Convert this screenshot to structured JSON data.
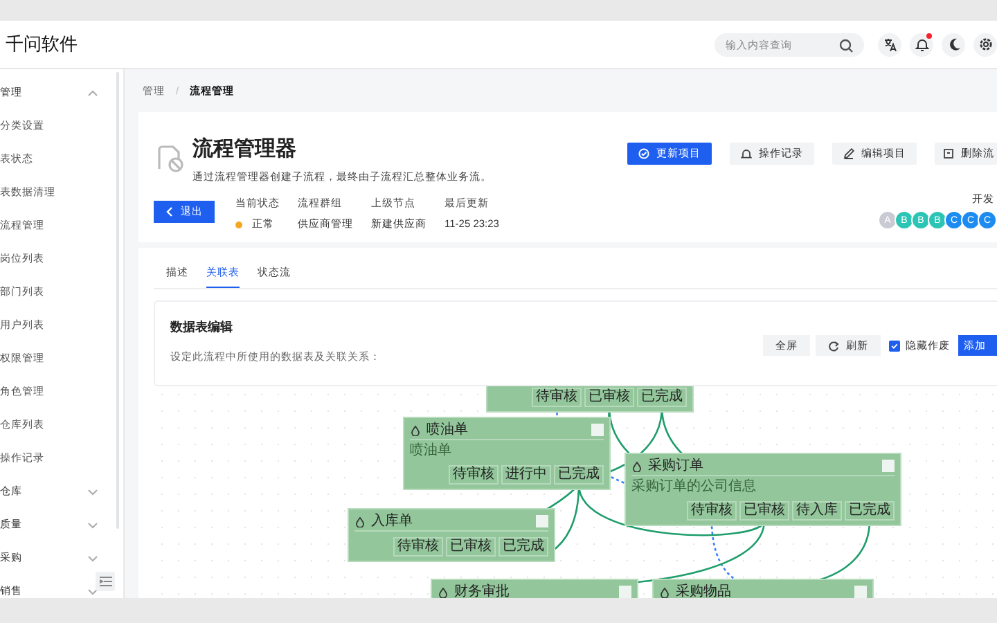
{
  "app": {
    "title": "千问软件"
  },
  "search": {
    "placeholder": "输入内容查询"
  },
  "toolbar_icons": [
    {
      "kind": "translate",
      "badge": false
    },
    {
      "kind": "bell",
      "badge": true
    },
    {
      "kind": "moon",
      "badge": false
    },
    {
      "kind": "settings",
      "badge": false
    }
  ],
  "sidebar": {
    "items": [
      {
        "label": "管理",
        "expanded": true,
        "children": [
          {
            "label": "分类设置"
          },
          {
            "label": "表状态"
          },
          {
            "label": "表数据清理"
          },
          {
            "label": "流程管理"
          },
          {
            "label": "岗位列表"
          },
          {
            "label": "部门列表"
          },
          {
            "label": "用户列表"
          },
          {
            "label": "权限管理"
          },
          {
            "label": "角色管理"
          },
          {
            "label": "仓库列表"
          },
          {
            "label": "操作记录"
          }
        ]
      },
      {
        "label": "仓库",
        "expanded": false
      },
      {
        "label": "质量",
        "expanded": false
      },
      {
        "label": "采购",
        "expanded": false
      },
      {
        "label": "销售",
        "expanded": false
      }
    ]
  },
  "breadcrumb": {
    "items": [
      "管理",
      "流程管理"
    ],
    "separator": "/"
  },
  "header": {
    "title": "流程管理器",
    "description": "通过流程管理器创建子流程，最终由子流程汇总整体业务流。",
    "back_button": "退出",
    "info": [
      {
        "label": "当前状态",
        "value": "正常",
        "color": "#f5a623"
      },
      {
        "label": "流程群组",
        "value": "供应商管理"
      },
      {
        "label": "上级节点",
        "value": "新建供应商"
      },
      {
        "label": "最后更新",
        "value": "11-25 23:23"
      }
    ],
    "actions": [
      {
        "label": "更新项目",
        "kind": "primary"
      },
      {
        "label": "操作记录",
        "kind": "history"
      },
      {
        "label": "编辑项目",
        "kind": "edit"
      },
      {
        "label": "删除流",
        "kind": "delete"
      }
    ],
    "developers": {
      "label": "开发",
      "avatars": [
        {
          "initial": "A",
          "color": "#c8cbd3"
        },
        {
          "initial": "B",
          "color": "#2cc5b5"
        },
        {
          "initial": "B",
          "color": "#2cc5b5"
        },
        {
          "initial": "B",
          "color": "#2cc5b5"
        },
        {
          "initial": "C",
          "color": "#1c8cf0"
        },
        {
          "initial": "C",
          "color": "#1c8cf0"
        },
        {
          "initial": "C",
          "color": "#1c8cf0"
        }
      ]
    }
  },
  "tabs": [
    {
      "label": "描述",
      "selected": false
    },
    {
      "label": "关联表",
      "selected": true
    },
    {
      "label": "状态流",
      "selected": false
    }
  ],
  "editor": {
    "title": "数据表编辑",
    "description": "设定此流程中所使用的数据表及关联关系：",
    "buttons": [
      {
        "label": "全屏",
        "kind": "plain"
      },
      {
        "label": "刷新",
        "kind": "refresh"
      },
      {
        "label": "隐藏作废",
        "kind": "checkbox",
        "checked": true
      },
      {
        "label": "添加",
        "kind": "primary"
      }
    ]
  },
  "diagram": {
    "nodes": [
      {
        "ports": [
          "待审核",
          "已审核",
          "已完成"
        ]
      },
      {
        "title": "喷油单",
        "subtitle": "喷油单",
        "ports": [
          "待审核",
          "进行中",
          "已完成"
        ]
      },
      {
        "title": "采购订单",
        "subtitle": "采购订单的公司信息",
        "ports": [
          "待审核",
          "已审核",
          "待入库",
          "已完成"
        ]
      },
      {
        "title": "入库单",
        "ports": [
          "待审核",
          "已审核",
          "已完成"
        ]
      },
      {
        "title": "财务审批"
      },
      {
        "title": "采购物品"
      }
    ]
  }
}
